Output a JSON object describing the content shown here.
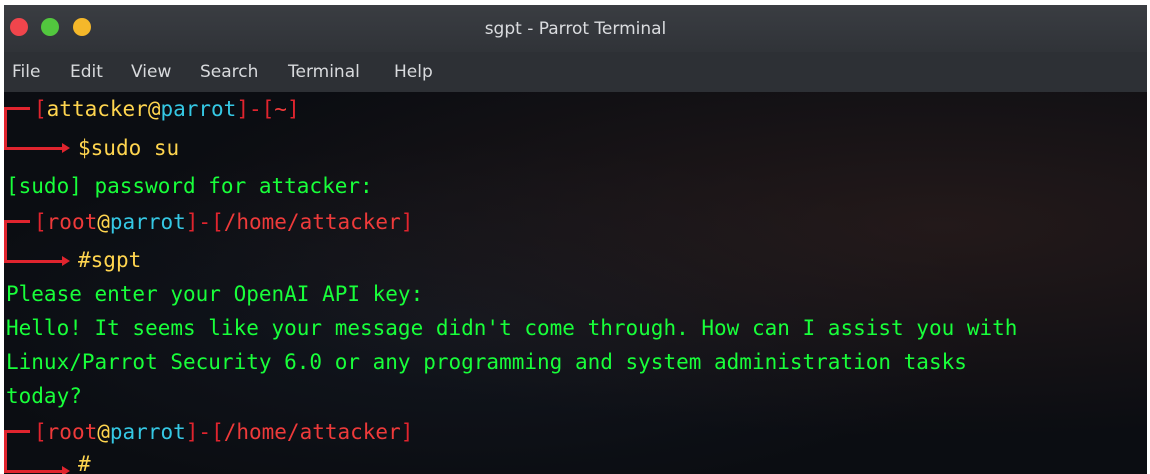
{
  "window": {
    "title": "sgpt - Parrot Terminal"
  },
  "menu": {
    "items": [
      "File",
      "Edit",
      "View",
      "Search",
      "Terminal",
      "Help"
    ]
  },
  "terminal": {
    "prompt1": {
      "open": "[",
      "user": "attacker",
      "at": "@",
      "host": "parrot",
      "close": "]",
      "sep": "-",
      "popen": "[",
      "path": "~",
      "pclose": "]"
    },
    "cmd1": {
      "sigil": "$",
      "text": "sudo su"
    },
    "out1": "[sudo] password for attacker:",
    "prompt2": {
      "open": "[",
      "user": "root",
      "at": "@",
      "host": "parrot",
      "close": "]",
      "sep": "-",
      "popen": "[",
      "path": "/home/attacker",
      "pclose": "]"
    },
    "cmd2": {
      "sigil": "#",
      "text": "sgpt"
    },
    "out2": "Please enter your OpenAI API key:",
    "out3": "Hello! It seems like your message didn't come through. How can I assist you with",
    "out4": "Linux/Parrot Security 6.0 or any programming and system administration tasks",
    "out5": "today?",
    "prompt3": {
      "open": "[",
      "user": "root",
      "at": "@",
      "host": "parrot",
      "close": "]",
      "sep": "-",
      "popen": "[",
      "path": "/home/attacker",
      "pclose": "]"
    },
    "cmd3": {
      "sigil": "#",
      "text": ""
    }
  },
  "colors": {
    "output": "#18ff3a",
    "bracket": "#e0242e",
    "host": "#35c8e4",
    "user": "#ffd54f"
  }
}
